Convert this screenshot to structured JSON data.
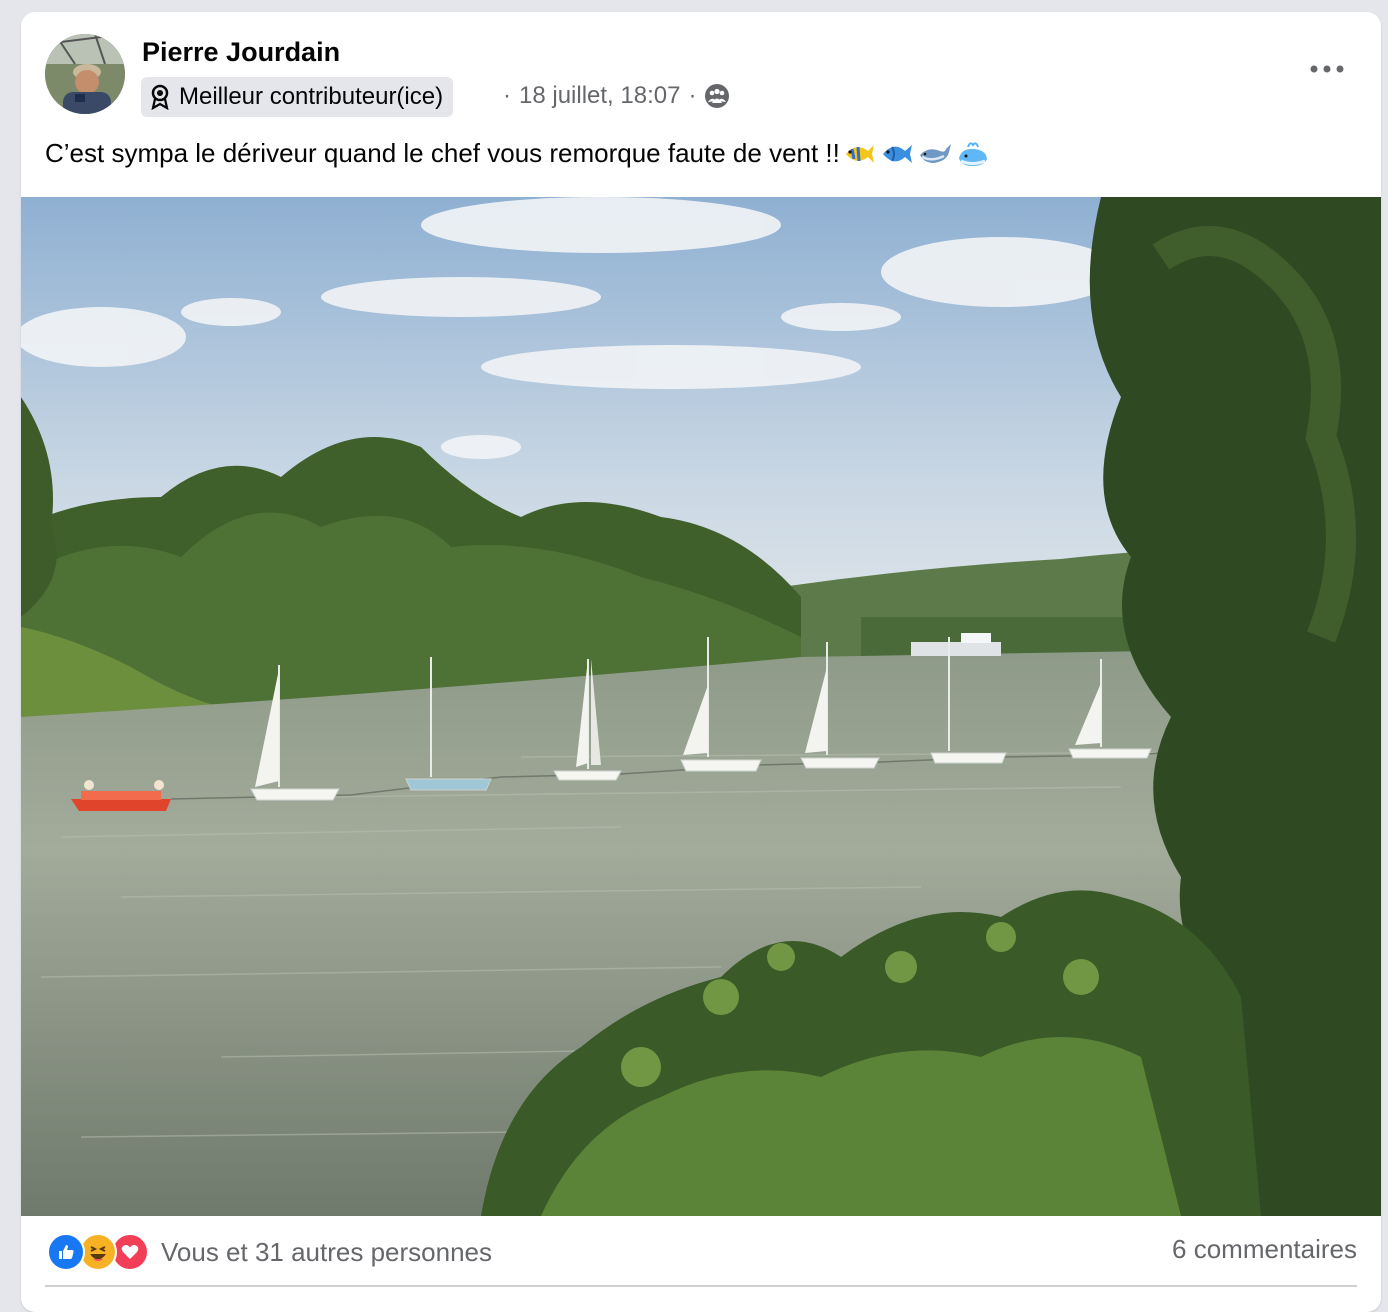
{
  "post": {
    "author": "Pierre Jourdain",
    "badge": "Meilleur contributeur(ice)",
    "meta_prefix": "·",
    "date": "18 juillet, 18:07",
    "meta_suffix": "·",
    "caption": "C’est sympa le dériveur quand le chef vous remorque faute de vent !!",
    "caption_emojis": [
      "tropical-fish-icon",
      "fish-icon",
      "whale-icon",
      "spouting-whale-icon"
    ],
    "privacy_icon": "group-icon",
    "more_icon": "more-options-icon",
    "image": "river-sailboats-photo"
  },
  "footer": {
    "reactions": [
      "like-icon",
      "haha-icon",
      "love-icon"
    ],
    "reactions_text": "Vous et 31 autres personnes",
    "comments": "6 commentaires"
  },
  "colors": {
    "background": "#e4e6eb",
    "card": "#ffffff",
    "secondary_text": "#65676b",
    "like_blue": "#1877f2",
    "love_red": "#f33e58",
    "haha_yellow": "#f7b125"
  }
}
